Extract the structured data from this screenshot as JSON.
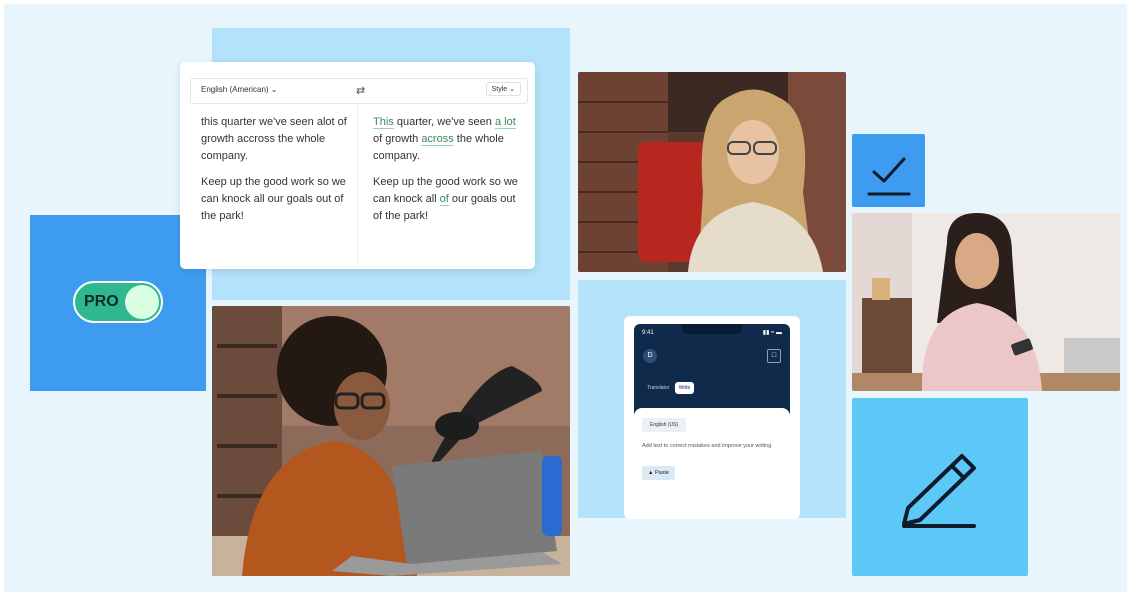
{
  "translator": {
    "source_lang": "English (American)",
    "swap_icon": "swap-icon",
    "style_label": "Style",
    "source_para1": "this quarter we've seen alot of growth accross the whole company.",
    "source_para2": "Keep up the good work so we can knock all our goals out of the park!",
    "fix_this": "This",
    "fix_mid1": " quarter, we've seen ",
    "fix_alot": "a lot",
    "fix_mid2": " of growth ",
    "fix_across": "across",
    "fix_end": " the whole company.",
    "target_para2a": "Keep up the good work so we can knock all ",
    "fix_of": "of",
    "target_para2b": " our goals out of the park!"
  },
  "toggle": {
    "label": "PRO",
    "state": "on"
  },
  "phone": {
    "time": "9:41",
    "signal": "▮▮ ≈ ▬",
    "avatar_initial": "D",
    "tabs": [
      "Translator",
      "Write"
    ],
    "active_tab": "Write",
    "language_chip": "English (US)",
    "hint": "Add text to correct mistakes and improve your writing.",
    "paste_label": "Paste"
  },
  "colors": {
    "background": "#e8f5fd",
    "tile_light": "#b3e3fb",
    "tile_blue": "#3e9cf0",
    "tile_sky": "#5cc8f8",
    "toggle_green": "#2fb890",
    "phone_navy": "#0f2a4a"
  }
}
